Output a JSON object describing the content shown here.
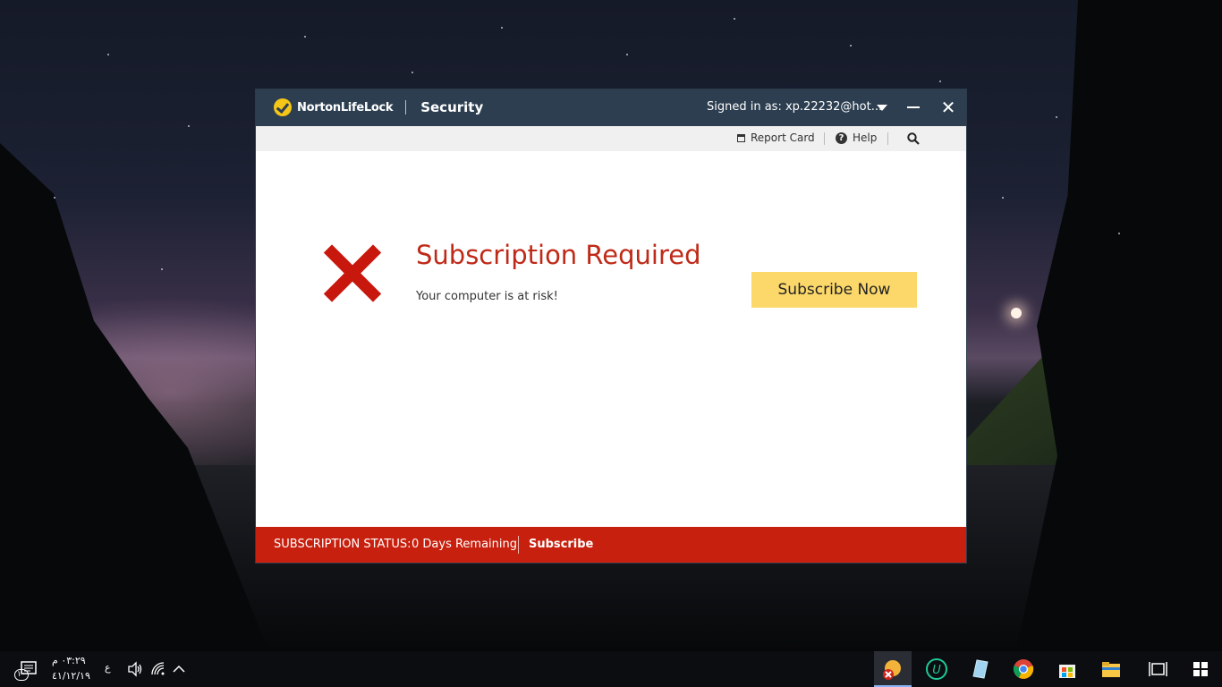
{
  "window": {
    "brand": "NortonLifeLock",
    "product": "Security",
    "signed_in": "Signed in as: xp.22232@hot...",
    "icons": {
      "dropdown": "chevron-down-icon",
      "minimize": "minimize-icon",
      "close": "close-icon"
    }
  },
  "toolbar": {
    "report_card": "Report Card",
    "help": "Help",
    "icons": {
      "report_card": "report-card-icon",
      "help": "help-icon",
      "search": "search-icon"
    }
  },
  "main": {
    "title": "Subscription Required",
    "message": "Your computer is at risk!",
    "subscribe_button": "Subscribe Now",
    "status_icon": "red-x-icon"
  },
  "statusbar": {
    "label": "SUBSCRIPTION STATUS:",
    "days": "0 Days Remaining",
    "link": "Subscribe"
  },
  "colors": {
    "titlebar": "#2c3e50",
    "accent_red": "#c8200e",
    "button_yellow": "#fcd86a",
    "headline_red": "#bf2a18"
  },
  "taskbar": {
    "time": "٠٣:٢٩ م",
    "date": "٤١/١٢/١٩",
    "notifications_count": "١٠",
    "language": "ع",
    "apps": [
      "norton-app-icon",
      "uplay-app-icon",
      "notes-app-icon",
      "chrome-app-icon",
      "store-app-icon",
      "file-explorer-app-icon",
      "task-view-icon",
      "start-icon"
    ]
  }
}
